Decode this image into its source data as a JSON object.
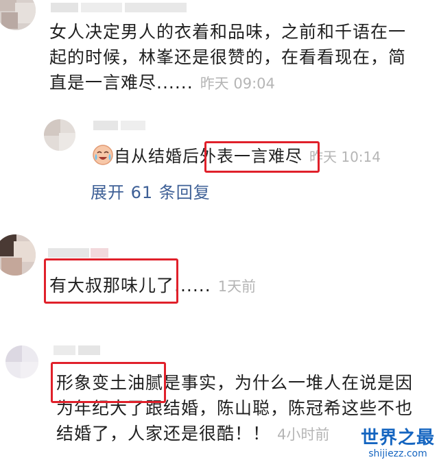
{
  "comments": [
    {
      "text": "女人决定男人的衣着和品味，之前和千语在一起的时候，林峯还是很赞的，在看看现在，简直是一言难尽......",
      "time": "昨天 09:04",
      "reply": {
        "prefix": "自从结婚后",
        "highlight": "外表一言难尽",
        "time": "昨天 10:14",
        "emoji": "crying-laughing-emoji"
      },
      "expand_label": "展开 61 条回复"
    },
    {
      "highlight": "有大叔那味儿了",
      "rest": "......",
      "time": "1天前"
    },
    {
      "highlight": "形象变土油腻",
      "rest_line1": "是事实，为什么一堆人在说是因",
      "line2": "为年纪大了跟结婚，陈山聪，陈冠希这些不也",
      "line3": "结婚了，人家还是很酷！！",
      "time": "4小时前"
    }
  ],
  "watermark": {
    "main": "世界之最",
    "sub": "shijiezz.com"
  },
  "colors": {
    "highlight_border": "#e0202a",
    "link": "#3d5f96",
    "timestamp": "#b5b5b5",
    "watermark": "#1565c0"
  }
}
